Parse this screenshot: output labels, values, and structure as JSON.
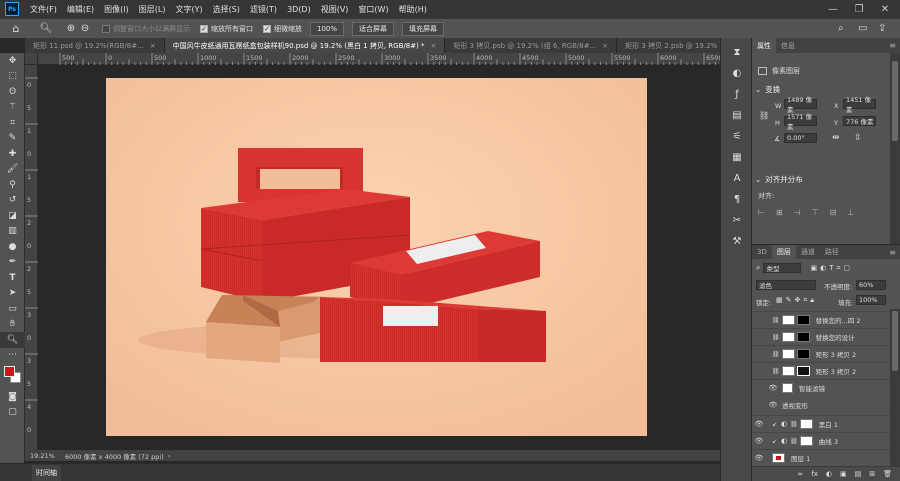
{
  "app": {
    "logo": "Ps"
  },
  "menu": [
    "文件(F)",
    "编辑(E)",
    "图像(I)",
    "图层(L)",
    "文字(Y)",
    "选择(S)",
    "滤镜(T)",
    "3D(D)",
    "视图(V)",
    "窗口(W)",
    "帮助(H)"
  ],
  "window_controls": {
    "minimize": "—",
    "restore": "❐",
    "close": "✕"
  },
  "options": {
    "resize_windows": "调整窗口大小以满屏显示",
    "zoom_all": "缩放所有窗口",
    "scrubby_zoom": "细微缩放",
    "zoom_value": "100%",
    "fit_screen": "适合屏幕",
    "fill_screen": "填充屏幕"
  },
  "tabs": [
    {
      "label": "矩形 11.psd @ 19.2%(RGB/8#...",
      "close": "×"
    },
    {
      "label": "中国风牛皮纸通用瓦楞纸盒包装样机90.psd @ 19.2% (黑白 1 拷贝, RGB/8#) *",
      "close": "×"
    },
    {
      "label": "矩形 3 拷贝.psb @ 19.2% (组 6, RGB/8#...",
      "close": "×"
    },
    {
      "label": "矩形 3 拷贝 2.psb @ 19.2% (组 6, RGB/8#...",
      "close": "×"
    }
  ],
  "tab_overflow": "»",
  "ruler_h": [
    "500",
    "0",
    "500",
    "1000",
    "1500",
    "2000",
    "2500",
    "3000",
    "3500",
    "4000",
    "4500",
    "5000",
    "5500",
    "6000",
    "6500"
  ],
  "ruler_v": [
    "0",
    "5",
    "1",
    "0",
    "1",
    "5",
    "2",
    "0",
    "2",
    "5",
    "3",
    "0",
    "3",
    "5",
    "4",
    "0"
  ],
  "status": {
    "zoom": "19.21%",
    "doc_info": "6000 像素 x 4000 像素 (72 ppi)",
    "arrow": "›"
  },
  "timeline": {
    "label": "时间轴"
  },
  "properties": {
    "tab_properties": "属性",
    "tab_info": "信息",
    "layer_type": "像素图层",
    "transform_title": "变换",
    "w_label": "W",
    "w_value": "1489 像素",
    "x_label": "X",
    "x_value": "1451 像素",
    "h_label": "H",
    "h_value": "1571 像素",
    "y_label": "Y",
    "y_value": "776 像素",
    "angle_value": "0.00°",
    "align_title": "对齐并分布",
    "align_label": "对齐:"
  },
  "layers_panel": {
    "tabs": [
      "3D",
      "图层",
      "通道",
      "路径"
    ],
    "filter_kind": "类型",
    "blend_mode": "滤色",
    "opacity_label": "不透明度:",
    "opacity_value": "60%",
    "lock_label": "锁定:",
    "fill_label": "填充:",
    "fill_value": "100%",
    "layers": [
      {
        "name": "替换您的...四 2"
      },
      {
        "name": "替换您的设计"
      },
      {
        "name": "矩形 3 拷贝 2"
      },
      {
        "name": "矩形 3 拷贝 2"
      },
      {
        "name": "智能滤镜"
      },
      {
        "name": "透视变形"
      },
      {
        "name": "黑白 1"
      },
      {
        "name": "曲线 3"
      },
      {
        "name": "图层 1"
      }
    ],
    "footer_icons": [
      "∞",
      "fx",
      "◐",
      "▣",
      "▤",
      "⊞",
      "🗑"
    ]
  },
  "colors": {
    "foreground": "#c8161d",
    "background": "#ffffff",
    "canvas_bg": "#f7c9a6",
    "box_red": "#d8322f",
    "tray": "#d89a6e"
  }
}
